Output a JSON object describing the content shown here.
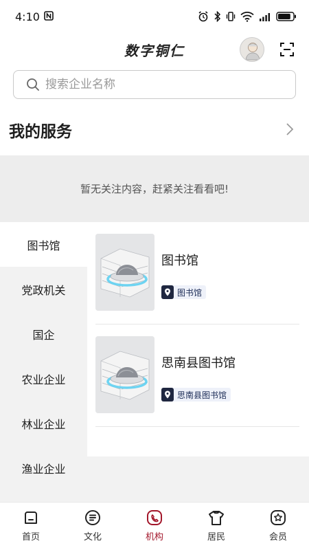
{
  "status_bar": {
    "time": "4:10",
    "battery_level": 0.85
  },
  "header": {
    "title": "数字铜仁"
  },
  "search": {
    "placeholder": "搜索企业名称"
  },
  "services": {
    "title": "我的服务",
    "empty_text": "暂无关注内容，赶紧关注看看吧!"
  },
  "categories": [
    {
      "label": "图书馆",
      "active": true
    },
    {
      "label": "党政机关"
    },
    {
      "label": "国企"
    },
    {
      "label": "农业企业"
    },
    {
      "label": "林业企业"
    },
    {
      "label": "渔业企业"
    }
  ],
  "cards": [
    {
      "title": "图书馆",
      "tag": "图书馆"
    },
    {
      "title": "思南县图书馆",
      "tag": "思南县图书馆"
    }
  ],
  "tabs": [
    {
      "label": "首页",
      "icon": "home-icon"
    },
    {
      "label": "文化",
      "icon": "culture-icon"
    },
    {
      "label": "机构",
      "icon": "institution-icon",
      "active": true
    },
    {
      "label": "居民",
      "icon": "resident-icon"
    },
    {
      "label": "会员",
      "icon": "member-icon"
    }
  ],
  "colors": {
    "accent": "#a3172b",
    "tag_bg": "#eef1f9",
    "tag_icon": "#1f2740",
    "panel_grey": "#f2f2f2"
  }
}
